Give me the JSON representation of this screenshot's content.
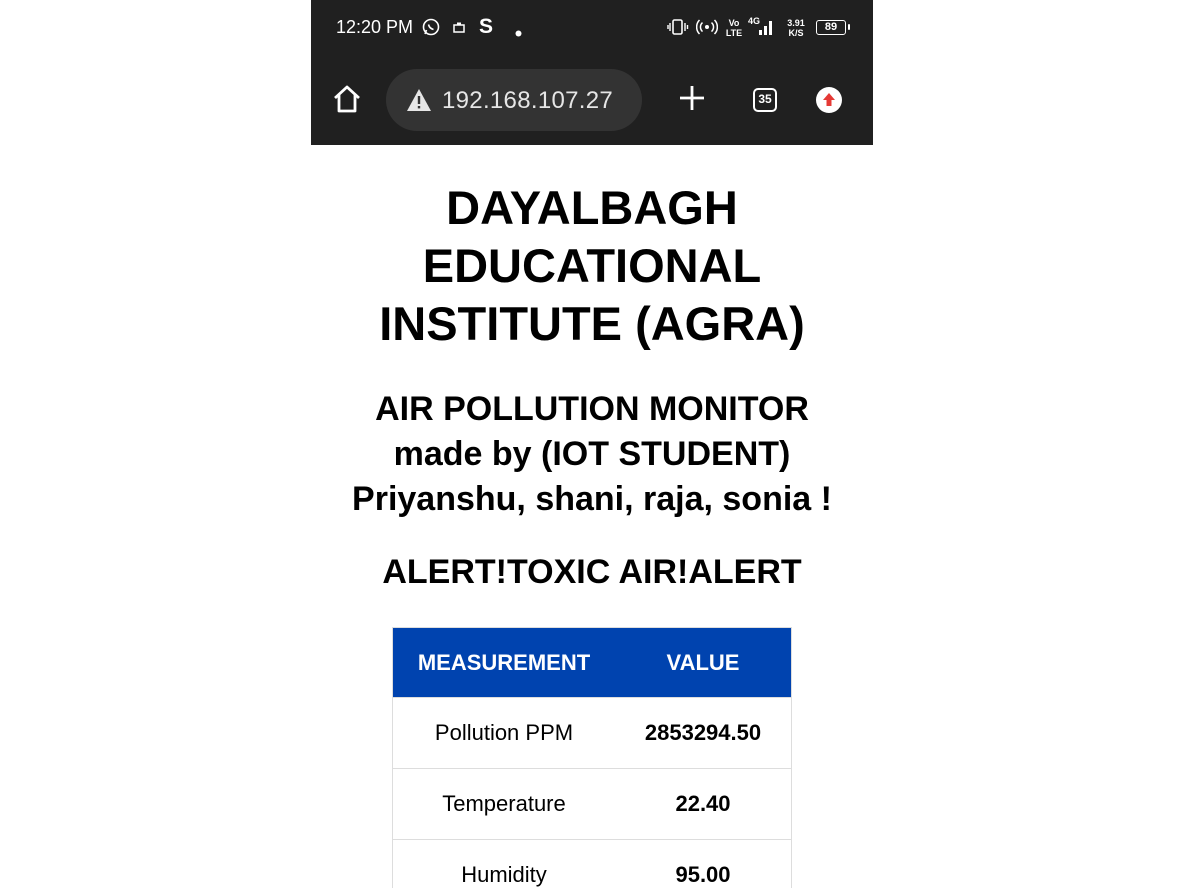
{
  "status_bar": {
    "time": "12:20 PM",
    "icons": [
      "whatsapp-icon",
      "notification-icon",
      "s-app-icon",
      "dot-icon",
      "vibrate-icon",
      "hotspot-icon",
      "volte-icon",
      "4g-signal-icon",
      "battery-icon"
    ],
    "volte_label": "Vo\nLTE",
    "network_label": "4G",
    "speed_value": "3.91",
    "speed_unit": "K/S",
    "battery": "89"
  },
  "browser": {
    "url": "192.168.107.27",
    "tab_count": "35",
    "colors": {
      "bar": "#202020",
      "url_box": "#333333",
      "update_badge": "#e53935"
    }
  },
  "page": {
    "institute_title": "DAYALBAGH EDUCATIONAL INSTITUTE (AGRA)",
    "project_line1": "AIR POLLUTION MONITOR",
    "project_line2": "made by (IOT STUDENT)",
    "project_line3": "Priyanshu, shani, raja, sonia !",
    "alert": "ALERT!TOXIC AIR!ALERT",
    "table": {
      "headers": [
        "MEASUREMENT",
        "VALUE"
      ],
      "header_color": "#0043af",
      "rows": [
        [
          "Pollution PPM",
          "2853294.50"
        ],
        [
          "Temperature",
          "22.40"
        ],
        [
          "Humidity",
          "95.00"
        ]
      ]
    }
  }
}
